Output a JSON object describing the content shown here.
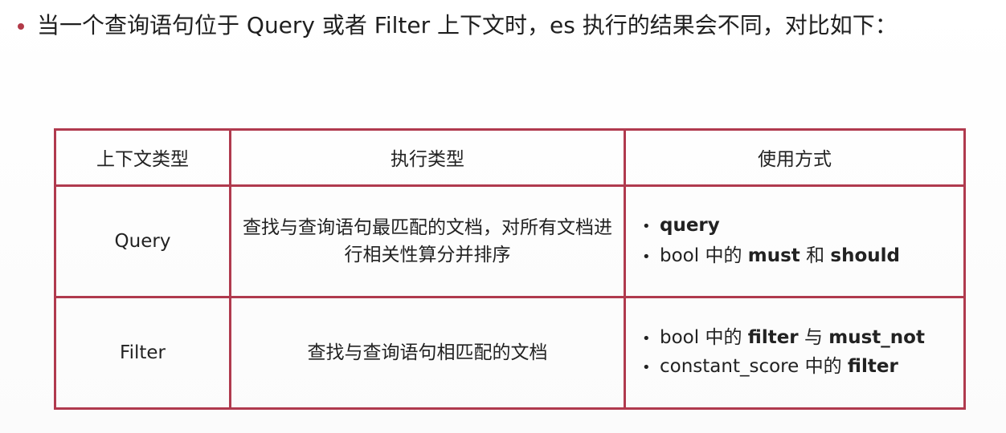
{
  "heading": {
    "text": "当一个查询语句位于 Query 或者 Filter 上下文时，es 执行的结果会不同，对比如下："
  },
  "table": {
    "headers": [
      "上下文类型",
      "执行类型",
      "使用方式"
    ],
    "rows": [
      {
        "context": "Query",
        "exec_type": "查找与查询语句最匹配的文档，对所有文档进行相关性算分并排序",
        "usage": [
          {
            "bullet": "•",
            "parts": [
              {
                "t": "query",
                "b": true
              }
            ]
          },
          {
            "bullet": "•",
            "parts": [
              {
                "t": "bool 中的 ",
                "b": false
              },
              {
                "t": "must",
                "b": true
              },
              {
                "t": " 和 ",
                "b": false
              },
              {
                "t": "should",
                "b": true
              }
            ]
          }
        ]
      },
      {
        "context": "Filter",
        "exec_type": "查找与查询语句相匹配的文档",
        "usage": [
          {
            "bullet": "•",
            "parts": [
              {
                "t": "bool 中的 ",
                "b": false
              },
              {
                "t": "filter",
                "b": true
              },
              {
                "t": " 与 ",
                "b": false
              },
              {
                "t": "must_not",
                "b": true
              }
            ]
          },
          {
            "bullet": "•",
            "parts": [
              {
                "t": "constant_score 中的 ",
                "b": false
              },
              {
                "t": "filter",
                "b": true
              }
            ]
          }
        ]
      }
    ]
  },
  "colors": {
    "border": "#b03a4e",
    "bullet": "#b23a48",
    "text": "#222222"
  }
}
